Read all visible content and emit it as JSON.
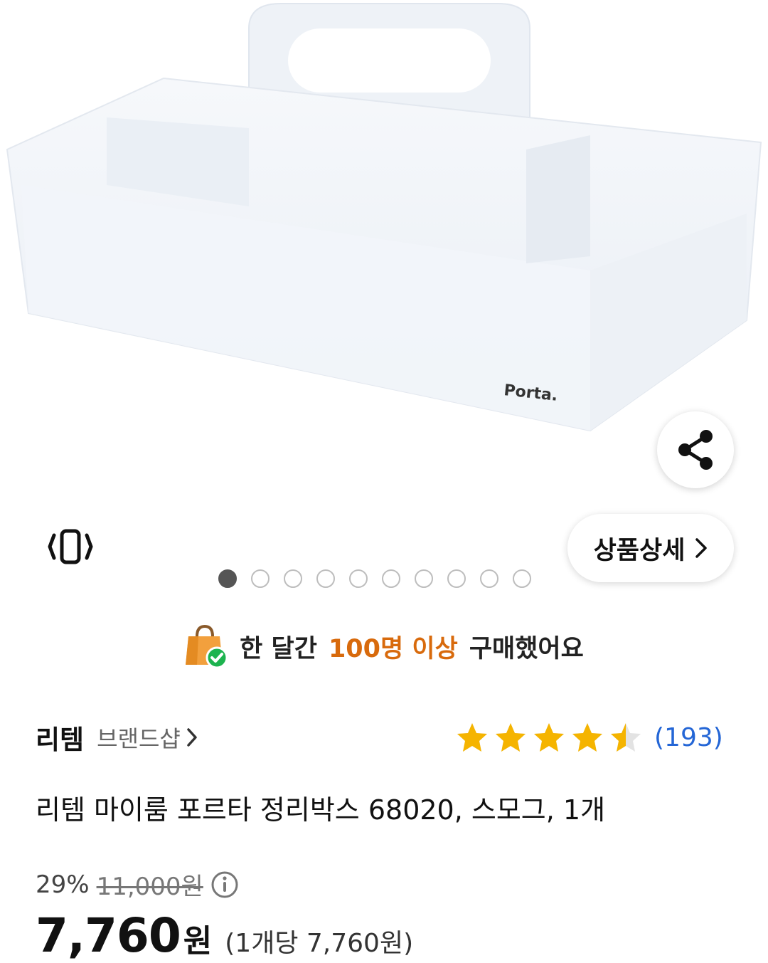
{
  "product_image": {
    "brand_mark": "Porta."
  },
  "share": {
    "icon": "share-icon"
  },
  "vibrate": {
    "icon": "vibrate-icon"
  },
  "detail_button": {
    "label": "상품상세"
  },
  "carousel": {
    "total": 10,
    "active": 1
  },
  "promo": {
    "icon": "shopping-bag-check-icon",
    "prefix": "한 달간",
    "highlight": "100명 이상",
    "suffix": "구매했어요"
  },
  "brand": {
    "name": "리템",
    "shop_label": "브랜드샵"
  },
  "rating": {
    "stars": 4.5,
    "count": "(193)"
  },
  "product": {
    "title": "리템 마이룸 포르타 정리박스 68020, 스모그, 1개"
  },
  "price": {
    "discount": "29%",
    "original": "11,000원",
    "current": "7,760",
    "currency": "원",
    "unit_price": "(1개당 7,760원)"
  },
  "colors": {
    "accent_orange": "#d86a0c",
    "link_blue": "#2466d6",
    "star": "#f5b400"
  }
}
